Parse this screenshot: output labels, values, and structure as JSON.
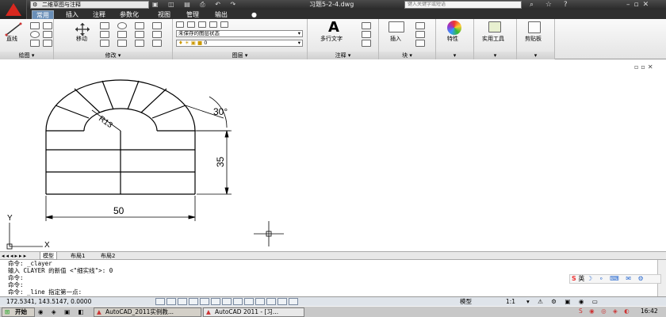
{
  "titlebar": {
    "workspace": "二维草图与注释",
    "quick_access": "▣ ◫ ▤ ⎙ ↶ ↷",
    "doc_title": "习题5-2-4.dwg",
    "search_placeholder": "键入关键字或短语",
    "title_icons": "⌕ ☆ ?"
  },
  "tabs": [
    "常用",
    "插入",
    "注释",
    "参数化",
    "视图",
    "管理",
    "输出",
    "●"
  ],
  "ribbon": {
    "draw": {
      "title": "绘图",
      "line_label": "直线"
    },
    "modify": {
      "title": "修改",
      "move_label": "移动"
    },
    "layers": {
      "title": "图层",
      "state": "未保存的图层状态",
      "current": "0"
    },
    "annotation": {
      "title": "注释",
      "mtext_label": "多行文字"
    },
    "block": {
      "title": "块",
      "insert_label": "插入"
    },
    "properties": {
      "title": "",
      "label": "特性"
    },
    "utilities": {
      "title": "",
      "label": "实用工具"
    },
    "clipboard": {
      "title": "",
      "label": "剪贴板"
    }
  },
  "drawing": {
    "dim_radius": "R13",
    "dim_angle": "30°",
    "dim_height": "35",
    "dim_width": "50",
    "ucs_y": "Y",
    "ucs_x": "X"
  },
  "layout_tabs": [
    "模型",
    "布局1",
    "布局2"
  ],
  "command_lines": [
    "命令: _clayer",
    "输入 CLAYER 的新值 <\"细实线\">: 0",
    "命令:",
    "命令:",
    "命令: _line 指定第一点:"
  ],
  "ime": {
    "label": "英"
  },
  "status": {
    "coords": "172.5341, 143.5147, 0.0000",
    "model_label": "模型",
    "scale": "1:1",
    "time": "16:42"
  },
  "taskbar": {
    "start": "开始",
    "tasks": [
      "AutoCAD_2011实例教...",
      "AutoCAD 2011 - [习..."
    ]
  },
  "colors": {
    "accent": "#6a8fb8",
    "app_red": "#d8281f"
  }
}
